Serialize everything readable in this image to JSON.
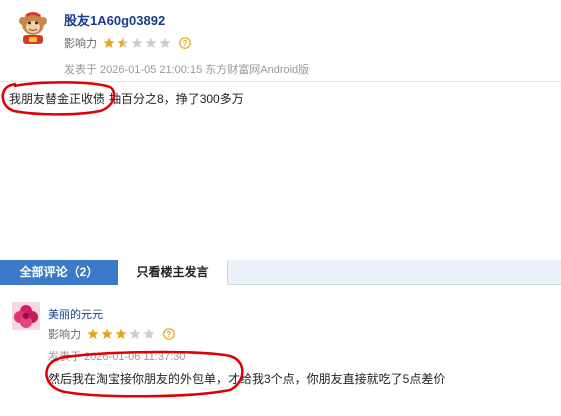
{
  "post": {
    "author": "股友1A60g03892",
    "influence_label": "影响力",
    "influence_stars": 1.5,
    "meta": "发表于 2026-01-05 21:00:15 东方财富网Android版",
    "body_highlight": "我朋友替金正收债",
    "body_rest": "抽百分之8，挣了300多万"
  },
  "tabs": {
    "all_label": "全部评论（2）",
    "owner_label": "只看楼主发言"
  },
  "comment": {
    "author": "美丽的元元",
    "influence_label": "影响力",
    "influence_stars": 3,
    "meta": "发表于 2026-01-06 11:37:30",
    "text": "然后我在淘宝接你朋友的外包单，才给我3个点，你朋友直接就吃了5点差价"
  },
  "colors": {
    "author_link": "#1a3c8a",
    "star_filled": "#e8a317",
    "star_empty": "#cccccc",
    "tab_active_bg": "#3b7ac9",
    "annotation_red": "#e00000"
  },
  "icons": {
    "post_avatar": "cartoon-monkey-avatar-icon",
    "comment_avatar": "flower-avatar-icon",
    "help": "question-circle-icon"
  }
}
